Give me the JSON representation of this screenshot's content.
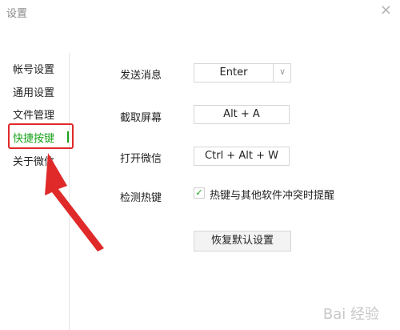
{
  "window": {
    "title": "设置",
    "close_icon": "close-icon"
  },
  "sidebar": {
    "items": [
      {
        "label": "帐号设置"
      },
      {
        "label": "通用设置"
      },
      {
        "label": "文件管理"
      },
      {
        "label": "快捷按键",
        "active": true
      },
      {
        "label": "关于微信"
      }
    ]
  },
  "shortcuts": {
    "send_message": {
      "label": "发送消息",
      "value": "Enter"
    },
    "screenshot": {
      "label": "截取屏幕",
      "value": "Alt + A"
    },
    "open_wechat": {
      "label": "打开微信",
      "value": "Ctrl + Alt + W"
    },
    "detect_hotkeys": {
      "label": "检测热键",
      "checkbox_label": "热键与其他软件冲突时提醒",
      "checked": true
    }
  },
  "buttons": {
    "reset_label": "恢复默认设置"
  },
  "watermark": {
    "text": "Bai 经验"
  },
  "colors": {
    "active_green": "#19a31a",
    "highlight_red": "#e02a2a"
  }
}
